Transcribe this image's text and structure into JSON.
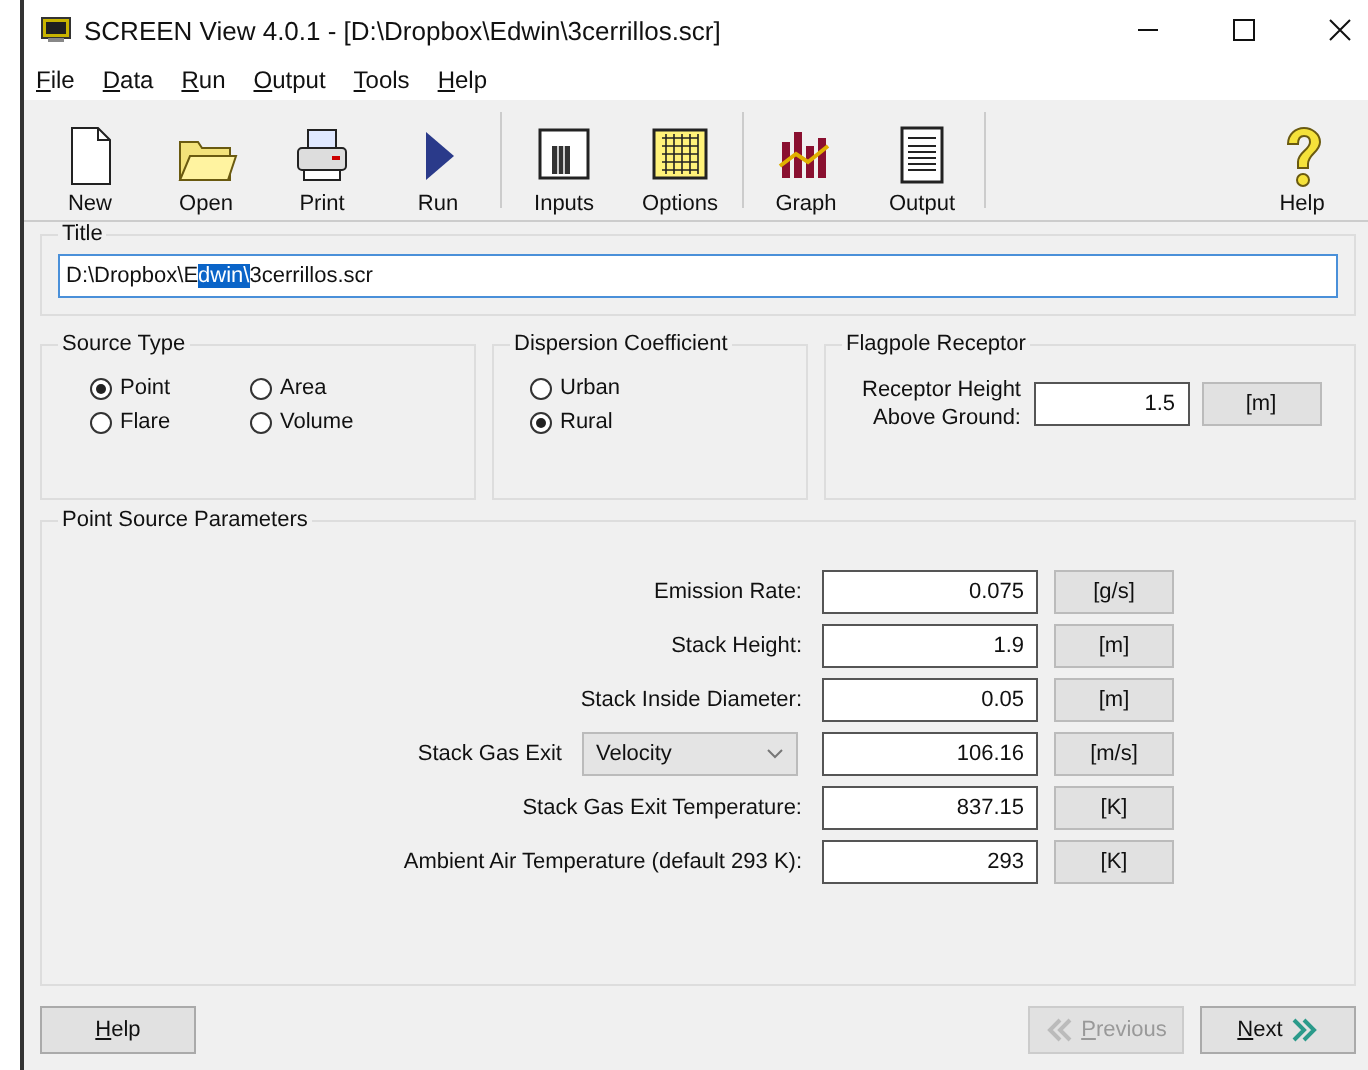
{
  "window": {
    "title": "SCREEN View 4.0.1 - [D:\\Dropbox\\Edwin\\3cerrillos.scr]"
  },
  "menu": [
    "File",
    "Data",
    "Run",
    "Output",
    "Tools",
    "Help"
  ],
  "toolbar": [
    {
      "label": "New",
      "kind": "new"
    },
    {
      "label": "Open",
      "kind": "open"
    },
    {
      "label": "Print",
      "kind": "print"
    },
    {
      "label": "Run",
      "kind": "run"
    },
    {
      "label": "Inputs",
      "kind": "inputs"
    },
    {
      "label": "Options",
      "kind": "options"
    },
    {
      "label": "Graph",
      "kind": "graph"
    },
    {
      "label": "Output",
      "kind": "output"
    },
    {
      "label": "Help",
      "kind": "help"
    }
  ],
  "title_group": {
    "legend": "Title",
    "value_before_selection": "D:\\Dropbox\\E",
    "selection": "dwin\\",
    "value_after_selection": "3cerrillos.scr"
  },
  "source_type": {
    "legend": "Source Type",
    "options": [
      {
        "label": "Point",
        "selected": true
      },
      {
        "label": "Area",
        "selected": false
      },
      {
        "label": "Flare",
        "selected": false
      },
      {
        "label": "Volume",
        "selected": false
      }
    ]
  },
  "dispersion": {
    "legend": "Dispersion Coefficient",
    "options": [
      {
        "label": "Urban",
        "selected": false
      },
      {
        "label": "Rural",
        "selected": true
      }
    ]
  },
  "flagpole": {
    "legend": "Flagpole Receptor",
    "label_line_1": "Receptor Height",
    "label_line_2": "Above Ground:",
    "value": "1.5",
    "unit": "[m]"
  },
  "point_source": {
    "legend": "Point Source Parameters",
    "rows": [
      {
        "kind": "label",
        "label": "Emission Rate:",
        "value": "0.075",
        "unit": "[g/s]"
      },
      {
        "kind": "label",
        "label": "Stack Height:",
        "value": "1.9",
        "unit": "[m]"
      },
      {
        "kind": "label",
        "label": "Stack Inside Diameter:",
        "value": "0.05",
        "unit": "[m]"
      },
      {
        "kind": "dropdown",
        "label": "Stack Gas Exit",
        "choice": "Velocity",
        "value": "106.16",
        "unit": "[m/s]"
      },
      {
        "kind": "label",
        "label": "Stack Gas Exit Temperature:",
        "value": "837.15",
        "unit": "[K]"
      },
      {
        "kind": "label",
        "label": "Ambient Air Temperature (default 293 K):",
        "value": "293",
        "unit": "[K]"
      }
    ]
  },
  "footer": {
    "help": "Help",
    "previous": {
      "label": "Previous",
      "disabled": true
    },
    "next": {
      "label": "Next",
      "disabled": false
    }
  }
}
